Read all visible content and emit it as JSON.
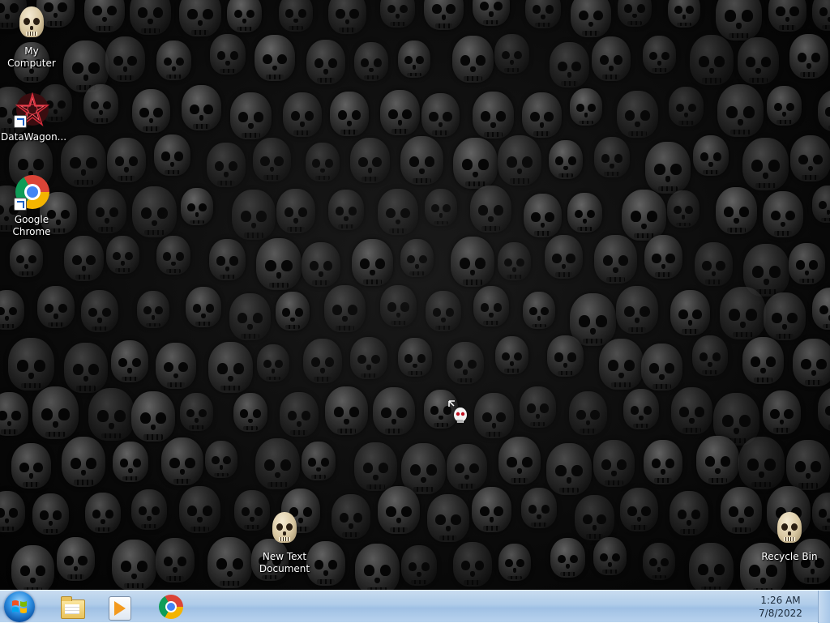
{
  "desktop": {
    "icons": [
      {
        "label": "My Computer",
        "icon": "skull-icon"
      },
      {
        "label": "DataWagon...",
        "icon": "datawagon-icon"
      },
      {
        "label": "Google Chrome",
        "icon": "chrome-icon"
      },
      {
        "label": "New Text Document",
        "icon": "skull-icon"
      },
      {
        "label": "Recycle Bin",
        "icon": "skull-icon"
      }
    ]
  },
  "taskbar": {
    "start_icon": "windows-logo-icon",
    "pinned": [
      {
        "name": "Windows Explorer",
        "icon": "folder-icon"
      },
      {
        "name": "Windows Media Player",
        "icon": "media-player-icon"
      },
      {
        "name": "Google Chrome",
        "icon": "chrome-icon"
      }
    ],
    "clock": {
      "time": "1:26 AM",
      "date": "7/8/2022"
    }
  },
  "colors": {
    "taskbar_top": "#c9dcf0",
    "taskbar_bottom": "#9fc0e4",
    "desktop_bg": "#080808",
    "icon_text": "#ffffff"
  }
}
